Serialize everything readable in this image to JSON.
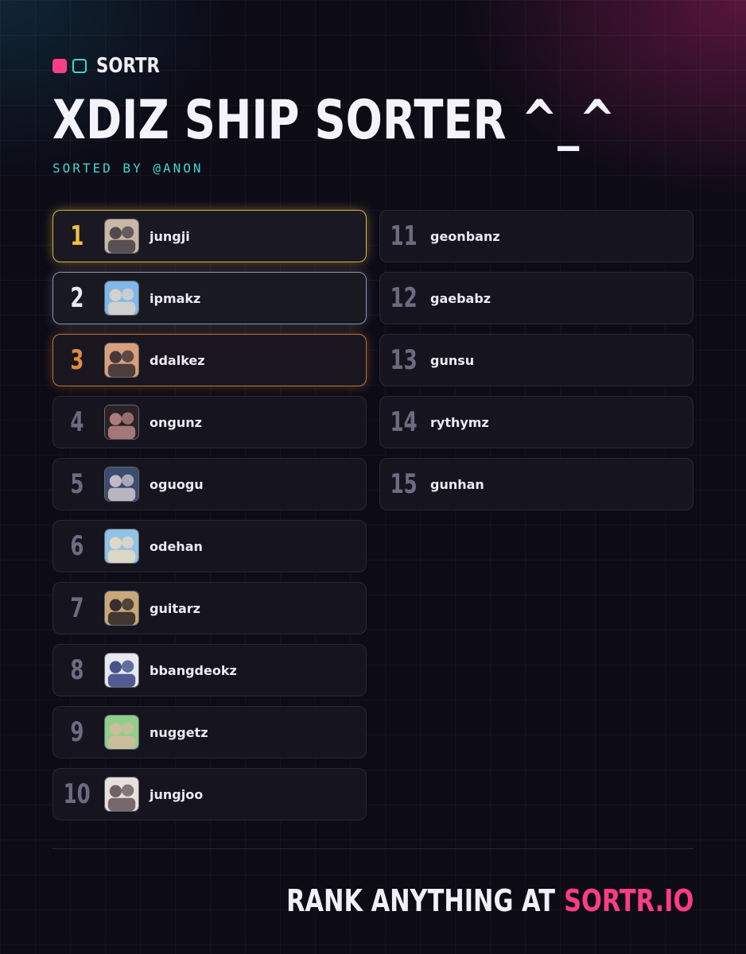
{
  "brand": {
    "name": "SORTR"
  },
  "title": "XDIZ SHIP SORTER ^_^",
  "subtitle": "SORTED BY @ANON",
  "left_items": [
    {
      "rank": "1",
      "name": "jungji",
      "tier": "gold",
      "colors": [
        "#c9b8a6",
        "#3a3440"
      ]
    },
    {
      "rank": "2",
      "name": "ipmakz",
      "tier": "silver",
      "colors": [
        "#7fb8e8",
        "#e6d5c8"
      ]
    },
    {
      "rank": "3",
      "name": "ddalkez",
      "tier": "bronze",
      "colors": [
        "#d8a07a",
        "#2b2430"
      ]
    },
    {
      "rank": "4",
      "name": "ongunz",
      "tier": "",
      "colors": [
        "#2a2326",
        "#c48c8e"
      ]
    },
    {
      "rank": "5",
      "name": "oguogu",
      "tier": "",
      "colors": [
        "#3c4b6e",
        "#d8cfd4"
      ]
    },
    {
      "rank": "6",
      "name": "odehan",
      "tier": "",
      "colors": [
        "#8fc2e4",
        "#f0dcc0"
      ]
    },
    {
      "rank": "7",
      "name": "guitarz",
      "tier": "",
      "colors": [
        "#c9a878",
        "#1e1a1f"
      ]
    },
    {
      "rank": "8",
      "name": "bbangdeokz",
      "tier": "",
      "colors": [
        "#e8e8f0",
        "#2a3a7a"
      ]
    },
    {
      "rank": "9",
      "name": "nuggetz",
      "tier": "",
      "colors": [
        "#8fcf8a",
        "#d8b8a0"
      ]
    },
    {
      "rank": "10",
      "name": "jungjoo",
      "tier": "",
      "colors": [
        "#e8e0dc",
        "#5a4a50"
      ]
    }
  ],
  "right_items": [
    {
      "rank": "11",
      "name": "geonbanz"
    },
    {
      "rank": "12",
      "name": "gaebabz"
    },
    {
      "rank": "13",
      "name": "gunsu"
    },
    {
      "rank": "14",
      "name": "rythymz"
    },
    {
      "rank": "15",
      "name": "gunhan"
    }
  ],
  "footer": {
    "prefix": "RANK ANYTHING AT",
    "link": "SORTR.IO"
  },
  "accent_colors": {
    "pink": "#ff3d86",
    "teal": "#3fd6cf",
    "gold": "#f2c040",
    "silver": "#e9e9f2",
    "bronze": "#e08a45"
  }
}
